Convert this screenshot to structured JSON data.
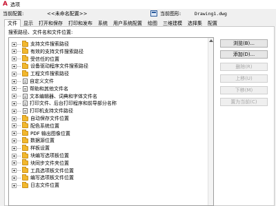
{
  "window": {
    "title": "选项"
  },
  "profile_bar": {
    "current_profile_label": "当前配置:",
    "current_profile_value": "<<未命名配置>>",
    "current_drawing_label": "当前图形:",
    "current_drawing_value": "Drawing1.dwg"
  },
  "tabs": [
    "文件",
    "显示",
    "打开和保存",
    "打印和发布",
    "系统",
    "用户系统配置",
    "绘图",
    "三维建模",
    "选择集",
    "配置"
  ],
  "active_tab": "文件",
  "panel": {
    "caption": "搜索路径、文件名和文件位置:"
  },
  "tree_items": [
    {
      "label": "支持文件搜索路径",
      "icon": "folder-icon"
    },
    {
      "label": "有效的支持文件搜索路径",
      "icon": "folder-icon"
    },
    {
      "label": "受信任的位置",
      "icon": "folder-icon"
    },
    {
      "label": "设备驱动程序文件搜索路径",
      "icon": "folder-icon"
    },
    {
      "label": "工程文件搜索路径",
      "icon": "folder-icon"
    },
    {
      "label": "自定义文件",
      "icon": "file-icon"
    },
    {
      "label": "帮助和其他文件名",
      "icon": "file-icon"
    },
    {
      "label": "文本编辑器、词典和字体文件名",
      "icon": "file-icon"
    },
    {
      "label": "打印文件、后台打印程序和前导部分名称",
      "icon": "file-icon"
    },
    {
      "label": "打印机支持文件路径",
      "icon": "file-icon"
    },
    {
      "label": "自动保存文件位置",
      "icon": "folder-icon"
    },
    {
      "label": "配色系统位置",
      "icon": "folder-icon"
    },
    {
      "label": "PDF 输出图像位置",
      "icon": "folder-icon"
    },
    {
      "label": "数据源位置",
      "icon": "folder-icon"
    },
    {
      "label": "样板设置",
      "icon": "folder-icon"
    },
    {
      "label": "块编写选项板位置",
      "icon": "folder-icon"
    },
    {
      "label": "块同步文件夹位置",
      "icon": "folder-icon"
    },
    {
      "label": "工具选项板文件位置",
      "icon": "folder-icon"
    },
    {
      "label": "编写选项板文件位置",
      "icon": "folder-icon"
    },
    {
      "label": "日志文件位置",
      "icon": "folder-icon"
    }
  ],
  "buttons": [
    {
      "label": "浏览(B)...",
      "enabled": true
    },
    {
      "label": "添加(D)...",
      "enabled": true
    },
    {
      "label": "删除(R)",
      "enabled": false
    },
    {
      "label": "上移(U)",
      "enabled": false
    },
    {
      "label": "下移(M)",
      "enabled": false
    },
    {
      "label": "置为当前(C)",
      "enabled": false
    }
  ],
  "colors": {
    "accent_logo": "#c8102e",
    "folder": "#f2b82e"
  }
}
